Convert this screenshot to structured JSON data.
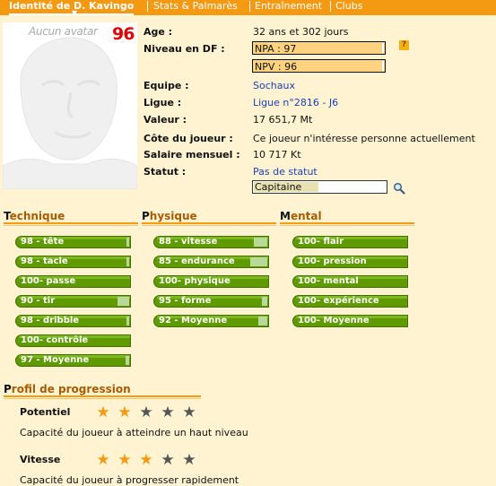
{
  "tabs": [
    {
      "label": "Identité de D. Kavingo",
      "active": true
    },
    {
      "label": "Stats & Palmarès",
      "active": false
    },
    {
      "label": "Entraînement",
      "active": false
    },
    {
      "label": "Clubs",
      "active": false
    }
  ],
  "avatar": {
    "text": "Aucun avatar",
    "score": "96"
  },
  "info": {
    "age_label": "Age :",
    "age_value": "32 ans et 302 jours",
    "niveau_label": "Niveau en DF :",
    "npa": "NPA : 97",
    "npv": "NPV : 96",
    "help_icon": "?",
    "equipe_label": "Equipe :",
    "equipe_value": "Sochaux",
    "ligue_label": "Ligue :",
    "ligue_value": "Ligue n°2816 - J6",
    "valeur_label": "Valeur :",
    "valeur_value": "17 651,7 Mt",
    "cote_label": "Côte du joueur :",
    "cote_value": "Ce joueur n'intéresse personne actuellement",
    "salaire_label": "Salaire mensuel :",
    "salaire_value": "10 717 Kt",
    "statut_label": "Statut :",
    "statut_value": "Pas de statut",
    "role_value": "Capitaine"
  },
  "sections": {
    "technique": {
      "cap": "T",
      "rest": "echnique"
    },
    "physique": {
      "cap": "P",
      "rest": "hysique"
    },
    "mental": {
      "cap": "M",
      "rest": "ental"
    },
    "profil": {
      "cap": "P",
      "rest": "rofil de progression"
    }
  },
  "technique": [
    {
      "label": "98 - tête",
      "value": 98
    },
    {
      "label": "98 - tacle",
      "value": 98
    },
    {
      "label": "100- passe",
      "value": 100
    },
    {
      "label": "90 - tir",
      "value": 90
    },
    {
      "label": "98 - dribble",
      "value": 98
    },
    {
      "label": "100- contrôle",
      "value": 100
    },
    {
      "label": "97 - Moyenne",
      "value": 97
    }
  ],
  "physique": [
    {
      "label": "88 - vitesse",
      "value": 88
    },
    {
      "label": "85 - endurance",
      "value": 85
    },
    {
      "label": "100- physique",
      "value": 100
    },
    {
      "label": "95 - forme",
      "value": 95
    },
    {
      "label": "92 - Moyenne",
      "value": 92
    }
  ],
  "mental": [
    {
      "label": "100- flair",
      "value": 100
    },
    {
      "label": "100- pression",
      "value": 100
    },
    {
      "label": "100- mental",
      "value": 100
    },
    {
      "label": "100- expérience",
      "value": 100
    },
    {
      "label": "100- Moyenne",
      "value": 100
    }
  ],
  "progression": [
    {
      "title": "Potentiel",
      "stars": 2,
      "max": 5,
      "desc": "Capacité du joueur à atteindre un haut niveau"
    },
    {
      "title": "Vitesse",
      "stars": 3,
      "max": 5,
      "desc": "Capacité du joueur à progresser rapidement"
    }
  ],
  "colors": {
    "accent": "#f39a12",
    "bar": "#5e9a00",
    "link": "#1a3fb8",
    "star_on": "#f39a12",
    "star_off": "#555555"
  }
}
